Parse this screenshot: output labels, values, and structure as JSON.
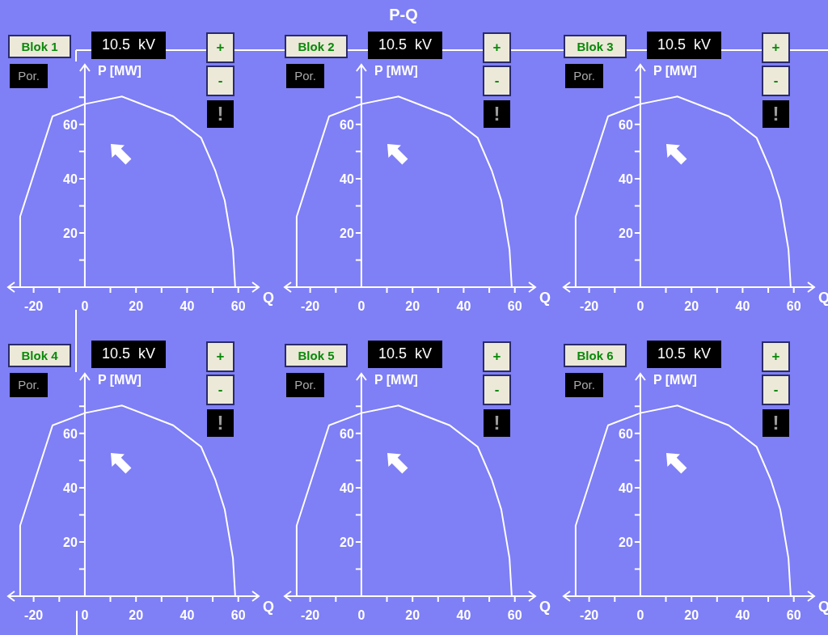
{
  "title": "P-Q",
  "units": [
    {
      "block_button": "Blok 1",
      "voltage": "10.5  kV",
      "mode": "Por.",
      "raise_button": "+",
      "lower_button": "-",
      "alarm": "!",
      "chart_data": {
        "type": "line",
        "xlabel": "Q",
        "ylabel": "P [MW]",
        "x": [
          -25.3,
          -25.3,
          -12.6,
          0,
          14.5,
          34.5,
          45.5,
          51,
          54.7,
          57.9,
          58.8
        ],
        "series": [
          {
            "color": "#ffffff",
            "values": [
              0,
              26,
              63,
              67.5,
              70.3,
              63,
              55,
              43,
              32,
              14,
              0
            ]
          }
        ],
        "xlim": [
          -30,
          68
        ],
        "ylim": [
          0,
          82
        ],
        "xticks": [
          -20,
          0,
          20,
          40,
          60
        ],
        "yticks": [
          20,
          40,
          60
        ]
      }
    },
    {
      "block_button": "Blok 2",
      "voltage": "10.5  kV",
      "mode": "Por.",
      "raise_button": "+",
      "lower_button": "-",
      "alarm": "!",
      "chart_data": {
        "type": "line",
        "xlabel": "Q",
        "ylabel": "P [MW]",
        "x": [
          -25.3,
          -25.3,
          -12.6,
          0,
          14.5,
          34.5,
          45.5,
          51,
          54.7,
          57.9,
          58.8
        ],
        "series": [
          {
            "color": "#ffffff",
            "values": [
              0,
              26,
              63,
              67.5,
              70.3,
              63,
              55,
              43,
              32,
              14,
              0
            ]
          }
        ],
        "xlim": [
          -30,
          68
        ],
        "ylim": [
          0,
          82
        ],
        "xticks": [
          -20,
          0,
          20,
          40,
          60
        ],
        "yticks": [
          20,
          40,
          60
        ]
      }
    },
    {
      "block_button": "Blok 3",
      "voltage": "10.5  kV",
      "mode": "Por.",
      "raise_button": "+",
      "lower_button": "-",
      "alarm": "!",
      "chart_data": {
        "type": "line",
        "xlabel": "Q",
        "ylabel": "P [MW]",
        "x": [
          -25.3,
          -25.3,
          -12.6,
          0,
          14.5,
          34.5,
          45.5,
          51,
          54.7,
          57.9,
          58.8
        ],
        "series": [
          {
            "color": "#ffffff",
            "values": [
              0,
              26,
              63,
              67.5,
              70.3,
              63,
              55,
              43,
              32,
              14,
              0
            ]
          }
        ],
        "xlim": [
          -30,
          68
        ],
        "ylim": [
          0,
          82
        ],
        "xticks": [
          -20,
          0,
          20,
          40,
          60
        ],
        "yticks": [
          20,
          40,
          60
        ]
      }
    },
    {
      "block_button": "Blok 4",
      "voltage": "10.5  kV",
      "mode": "Por.",
      "raise_button": "+",
      "lower_button": "-",
      "alarm": "!",
      "chart_data": {
        "type": "line",
        "xlabel": "Q",
        "ylabel": "P [MW]",
        "x": [
          -25.3,
          -25.3,
          -12.6,
          0,
          14.5,
          34.5,
          45.5,
          51,
          54.7,
          57.9,
          58.8
        ],
        "series": [
          {
            "color": "#ffffff",
            "values": [
              0,
              26,
              63,
              67.5,
              70.3,
              63,
              55,
              43,
              32,
              14,
              0
            ]
          }
        ],
        "xlim": [
          -30,
          68
        ],
        "ylim": [
          0,
          82
        ],
        "xticks": [
          -20,
          0,
          20,
          40,
          60
        ],
        "yticks": [
          20,
          40,
          60
        ]
      }
    },
    {
      "block_button": "Blok 5",
      "voltage": "10.5  kV",
      "mode": "Por.",
      "raise_button": "+",
      "lower_button": "-",
      "alarm": "!",
      "chart_data": {
        "type": "line",
        "xlabel": "Q",
        "ylabel": "P [MW]",
        "x": [
          -25.3,
          -25.3,
          -12.6,
          0,
          14.5,
          34.5,
          45.5,
          51,
          54.7,
          57.9,
          58.8
        ],
        "series": [
          {
            "color": "#ffffff",
            "values": [
              0,
              26,
              63,
              67.5,
              70.3,
              63,
              55,
              43,
              32,
              14,
              0
            ]
          }
        ],
        "xlim": [
          -30,
          68
        ],
        "ylim": [
          0,
          82
        ],
        "xticks": [
          -20,
          0,
          20,
          40,
          60
        ],
        "yticks": [
          20,
          40,
          60
        ]
      }
    },
    {
      "block_button": "Blok 6",
      "voltage": "10.5  kV",
      "mode": "Por.",
      "raise_button": "+",
      "lower_button": "-",
      "alarm": "!",
      "chart_data": {
        "type": "line",
        "xlabel": "Q",
        "ylabel": "P [MW]",
        "x": [
          -25.3,
          -25.3,
          -12.6,
          0,
          14.5,
          34.5,
          45.5,
          51,
          54.7,
          57.9,
          58.8
        ],
        "series": [
          {
            "color": "#ffffff",
            "values": [
              0,
              26,
              63,
              67.5,
              70.3,
              63,
              55,
              43,
              32,
              14,
              0
            ]
          }
        ],
        "xlim": [
          -30,
          68
        ],
        "ylim": [
          0,
          82
        ],
        "xticks": [
          -20,
          0,
          20,
          40,
          60
        ],
        "yticks": [
          20,
          40,
          60
        ]
      }
    }
  ]
}
